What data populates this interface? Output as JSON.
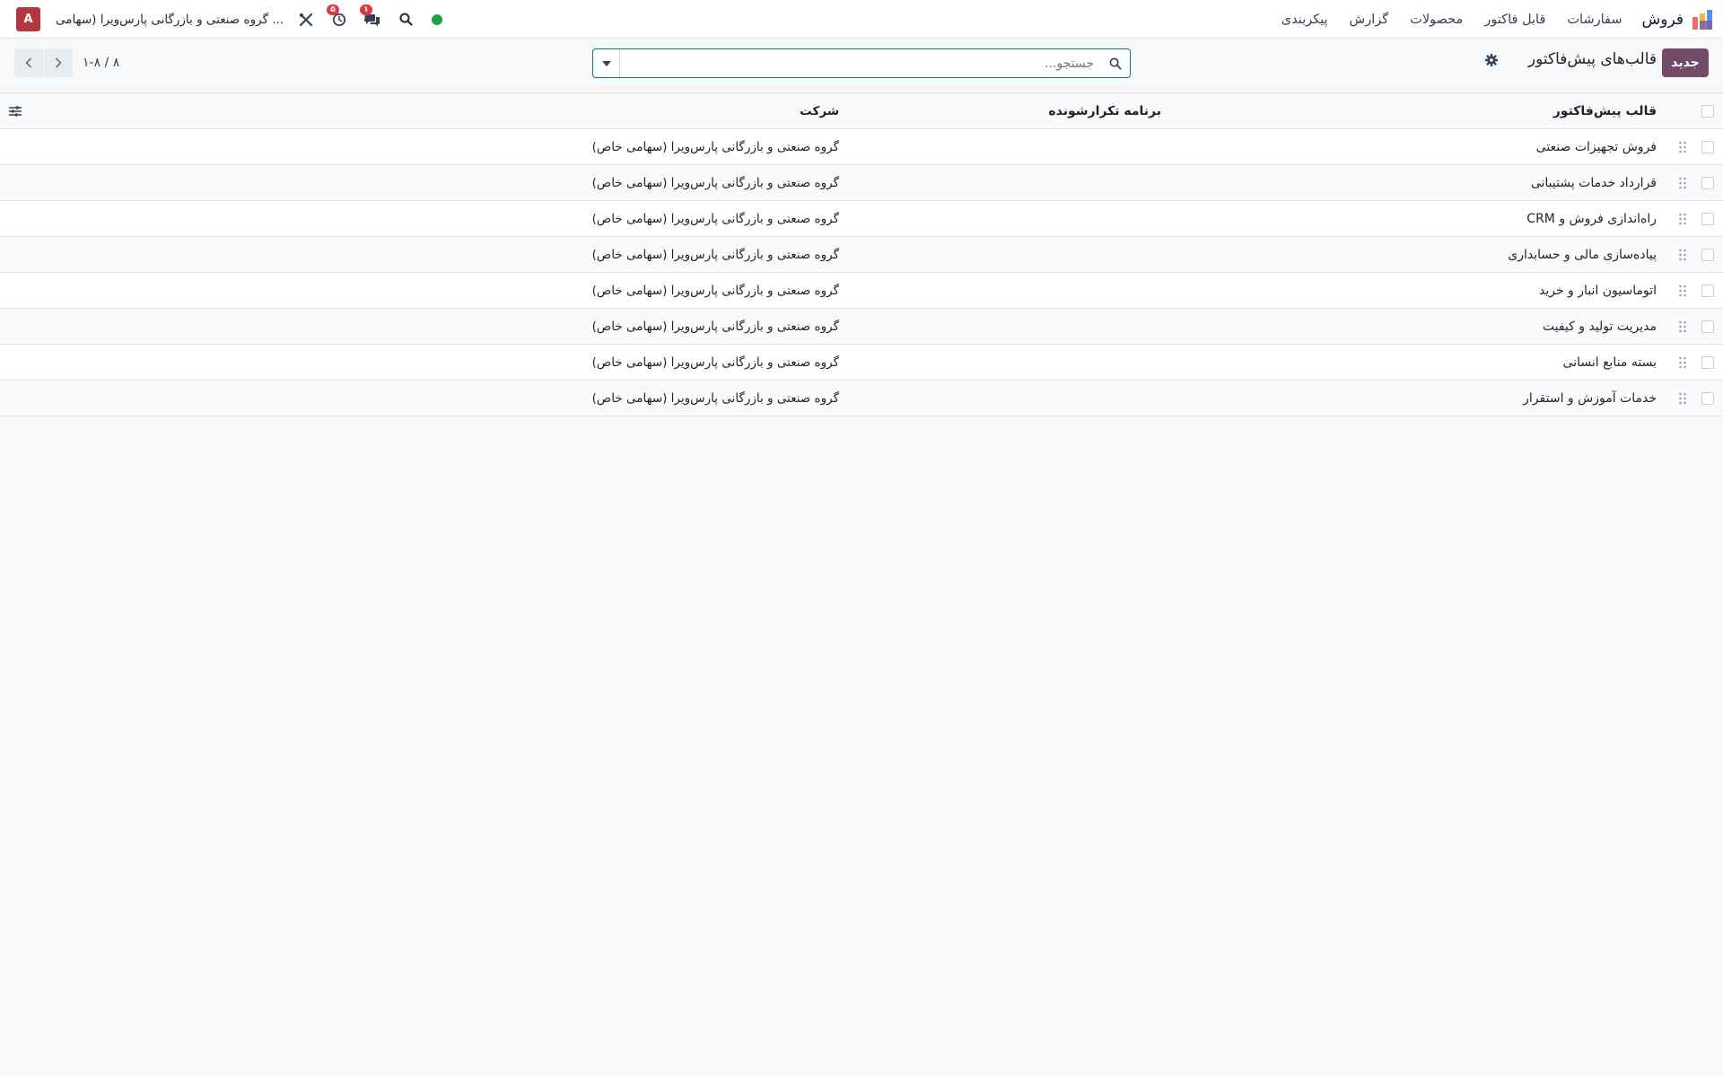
{
  "navbar": {
    "app_name": "فروش",
    "menu": [
      "سفارشات",
      "قابل فاکتور",
      "محصولات",
      "گزارش",
      "پیکربندی"
    ],
    "avatar_letter": "A",
    "company": "گروه صنعتی و بازرگانی پارس‌ویرا (سهامی ...",
    "activity_count": "۵",
    "messages_count": "۱",
    "status_color": "#1ea04b"
  },
  "control": {
    "new_label": "جدید",
    "title": "قالب‌های پیش‌فاکتور",
    "search_placeholder": "جستجو...",
    "pager_value": "۱-۸ / ۸"
  },
  "table": {
    "columns": {
      "name": "قالب پیش‌فاکتور",
      "recurring": "برنامه تکرارشونده",
      "company": "شرکت"
    },
    "rows": [
      {
        "name": "فروش تجهیزات صنعتی",
        "recurring": "",
        "company": "گروه صنعتی و بازرگانی پارس‌ویرا (سهامی خاص)"
      },
      {
        "name": "قرارداد خدمات پشتیبانی",
        "recurring": "",
        "company": "گروه صنعتی و بازرگانی پارس‌ویرا (سهامی خاص)"
      },
      {
        "name": "راه‌اندازی فروش و CRM",
        "recurring": "",
        "company": "گروه صنعتی و بازرگانی پارس‌ویرا (سهامی خاص)"
      },
      {
        "name": "پیاده‌سازی مالی و حسابداری",
        "recurring": "",
        "company": "گروه صنعتی و بازرگانی پارس‌ویرا (سهامی خاص)"
      },
      {
        "name": "اتوماسیون انبار و خرید",
        "recurring": "",
        "company": "گروه صنعتی و بازرگانی پارس‌ویرا (سهامی خاص)"
      },
      {
        "name": "مدیریت تولید و کیفیت",
        "recurring": "",
        "company": "گروه صنعتی و بازرگانی پارس‌ویرا (سهامی خاص)"
      },
      {
        "name": "بسته منابع انسانی",
        "recurring": "",
        "company": "گروه صنعتی و بازرگانی پارس‌ویرا (سهامی خاص)"
      },
      {
        "name": "خدمات آموزش و استقرار",
        "recurring": "",
        "company": "گروه صنعتی و بازرگانی پارس‌ویرا (سهامی خاص)"
      }
    ]
  },
  "colors": {
    "brand": "#714b67",
    "search_border": "#017e84",
    "badge": "#d93a45",
    "avatar_bg": "#b0383e"
  },
  "icons": {
    "app": "sales-app-icon",
    "search": "search-icon",
    "messages": "chat-icon",
    "activity": "clock-icon",
    "debug": "tools-icon",
    "gear": "gear-icon",
    "drag": "drag-handle-icon",
    "optional_columns": "sliders-icon"
  }
}
